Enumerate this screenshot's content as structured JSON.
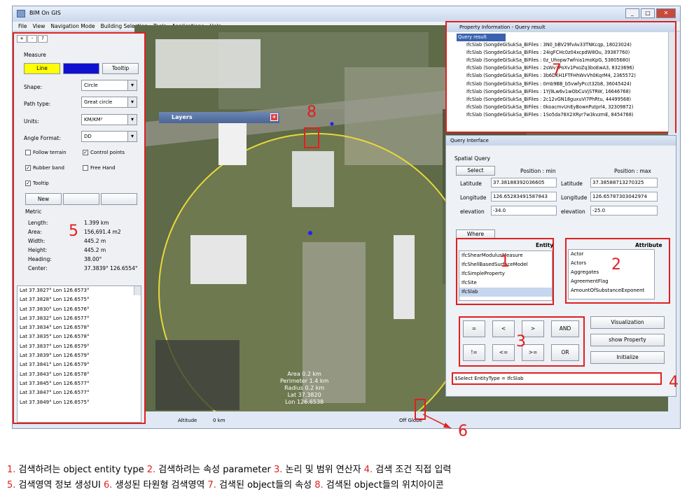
{
  "app": {
    "title": "BIM On GIS"
  },
  "menu": [
    "File",
    "View",
    "Navigation Mode",
    "Building Selection",
    "Tools",
    "Applications",
    "Help"
  ],
  "measure": {
    "tabs": [
      "+",
      "-",
      "?"
    ],
    "heading": "Measure",
    "line_button": "Line",
    "tooltip_button": "Tooltip",
    "shape_label": "Shape:",
    "shape_value": "Circle",
    "path_label": "Path type:",
    "path_value": "Great circle",
    "units_label": "Units:",
    "units_value": "KM/KM²",
    "angle_label": "Angle Format:",
    "angle_value": "DD",
    "follow_terrain": "Follow terrain",
    "control_points": "Control points",
    "rubber_band": "Rubber band",
    "free_hand": "Free Hand",
    "tooltip_check": "Tooltip",
    "new_button": "New",
    "metric_heading": "Metric",
    "metrics": [
      {
        "k": "Length:",
        "v": "1.399 km"
      },
      {
        "k": "Area:",
        "v": "156,691.4 m2"
      },
      {
        "k": "Width:",
        "v": "445.2 m"
      },
      {
        "k": "Height:",
        "v": "445.2 m"
      },
      {
        "k": "Heading:",
        "v": "38.00°"
      },
      {
        "k": "Center:",
        "v": "37.3839° 126.6554°"
      }
    ],
    "points": [
      "Lat 37.3827° Lon 126.6573°",
      "Lat 37.3828° Lon 126.6575°",
      "Lat 37.3830° Lon 126.6576°",
      "Lat 37.3832° Lon 126.6577°",
      "Lat 37.3834° Lon 126.6578°",
      "Lat 37.3835° Lon 126.6578°",
      "Lat 37.3837° Lon 126.6579°",
      "Lat 37.3839° Lon 126.6579°",
      "Lat 37.3841° Lon 126.6579°",
      "Lat 37.3843° Lon 126.6578°",
      "Lat 37.3845° Lon 126.6577°",
      "Lat 37.3847° Lon 126.6577°",
      "Lat 37.3849° Lon 126.6575°"
    ]
  },
  "layers": {
    "title": "Layers"
  },
  "map": {
    "tooltip": [
      "Area 0.2 km",
      "Perimeter 1.4 km",
      "Radius 0.2 km",
      "Lat 37.3820",
      "Lon 126.6538"
    ],
    "altitude": "Altitude",
    "altitude_value": "0 km",
    "off_globe": "Off Globe"
  },
  "property": {
    "title": "Property Information - Query result",
    "root": "Query result",
    "rows": [
      "IfcSlab (SongdeGiSukSa_BiFiles : 3N0_bBV29fvAv33TNKcqp, 18023024)",
      "IfcSlab (SongdeGiSukSa_BiFiles : 24igFCHc0z04xcpdW8Ou, 39387760)",
      "IfcSlab (SongdeGiSukSa_BiFiles : 0z_Uhopw7wfnia1moKpG, 53805680)",
      "IfcSlab (SongdeGiSukSa_BiFiles : 2sWv3PoXv1PxoZq3boEwA3, 8323696)",
      "IfcSlab (SongdeGiSukSa_BiFiles : 3b6DKH1FTFHhWvVh0KqrM4, 2365572)",
      "IfcSlab (SongdeGiSukSa_BiFiles : 0mb9BB_b5vwfyPcct32b8, 36045424)",
      "IfcSlab (SongdeGiSukSa_BiFiles : 1Yj9Lw6v1wObCuVjSTRW, 16646768)",
      "IfcSlab (SongdeGiSukSa_BiFiles : 2c12vGN18guxuVI7PhRtu, 44499568)",
      "IfcSlab (SongdeGiSukSa_BiFiles : 0koacmvUnEyBownPutprl4, 32309872)",
      "IfcSlab (SongdeGiSukSa_BiFiles : 1So5da78X2XRyr7w3kvzmE, 8454768)"
    ]
  },
  "query": {
    "title": "Query Interface",
    "spatial": "Spatial Query",
    "select_btn": "Select",
    "pos_min": "Position : min",
    "pos_max": "Position : max",
    "lat_label": "Latitude",
    "lat_min": "37.38188392036605",
    "lat_max": "37.38588713270325",
    "lon_label": "Longitude",
    "lon_min": "126.65283491587843",
    "lon_max": "126.65787303042974",
    "elev_label": "elevation",
    "elev_min": "-34.0",
    "elev_max": "-25.0",
    "where_tab": "Where",
    "entity_header": "Entity",
    "attribute_header": "Attribute",
    "entities": [
      "IfcShearModulusMeasure",
      "IfcShellBasedSurfaceModel",
      "IfcSimpleProperty",
      "IfcSite",
      "IfcSlab"
    ],
    "attributes": [
      "Actor",
      "Actors",
      "Aggregates",
      "AgreementFlag",
      "AmountOfSubstanceExponent"
    ],
    "ops": [
      "=",
      "<",
      ">",
      "AND",
      "!=",
      "<=",
      ">=",
      "OR"
    ],
    "visualization": "Visualization",
    "show_property": "show Property",
    "initialize": "Initialize",
    "condition": "$Select EntityType = IfcSlab"
  },
  "numbers": [
    "1",
    "2",
    "3",
    "4",
    "5",
    "6",
    "7",
    "8"
  ],
  "caption": {
    "l1": [
      {
        "n": "1.",
        "t": " 검색하려는 object entity type "
      },
      {
        "n": "2.",
        "t": " 검색하려는 속성 parameter "
      },
      {
        "n": "3.",
        "t": " 논리 및 범위 연산자 "
      },
      {
        "n": "4.",
        "t": " 검색 조건 직접 입력"
      }
    ],
    "l2": [
      {
        "n": "5.",
        "t": " 검색영역 정보 생성UI "
      },
      {
        "n": "6.",
        "t": " 생성된 타원형 검색영역 "
      },
      {
        "n": "7.",
        "t": " 검색된 object들의 속성 "
      },
      {
        "n": "8.",
        "t": " 검색된 object들의 위치아이콘"
      }
    ]
  },
  "colors": {
    "line_btn": "#ffff00",
    "blue_btn": "#1010d0",
    "annotation": "#e02020"
  }
}
